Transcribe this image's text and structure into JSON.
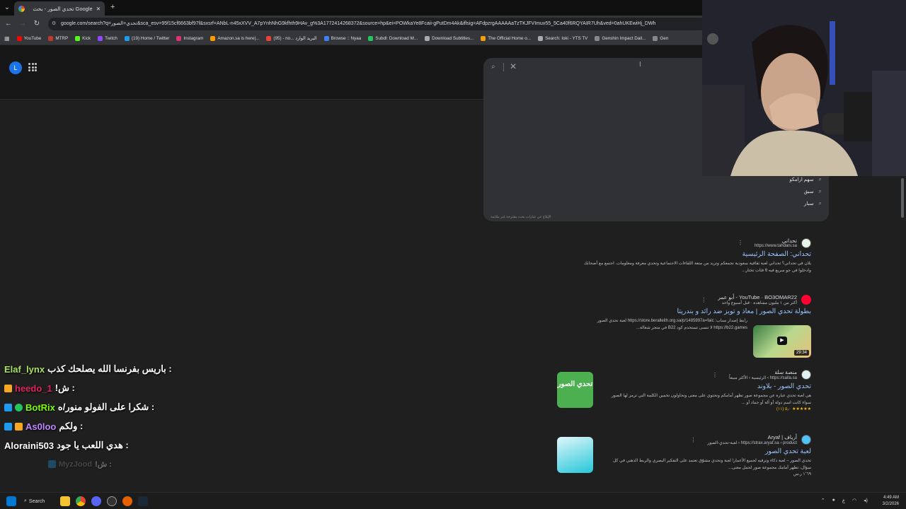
{
  "browser": {
    "tab_title": "تحدي الصور - بحث Google",
    "url": "google.com/search?q=تحدي+الصور&sca_esv=95f15cf6663bf97f&sxsrf=ANbL-n45xXVV_A7pYnhNhG9kfhth9HAv_g%3A1772414268372&source=hp&ei=POWkaYe8Fcaii-gPutDm4Ak&iflsig=AFdpzrgAAAAAaTzTKJFVImuv55_5Ca40f6RQYAIR7Uh&ved=0ahUKEwiHj_DWh",
    "bookmarks": [
      {
        "label": "YouTube",
        "color": "#ff0000"
      },
      {
        "label": "MTRP",
        "color": "#c0392b"
      },
      {
        "label": "Kick",
        "color": "#53fc18"
      },
      {
        "label": "Twitch",
        "color": "#9146ff"
      },
      {
        "label": "(19) Home / Twitter",
        "color": "#1d9bf0"
      },
      {
        "label": "Instagram",
        "color": "#e1306c"
      },
      {
        "label": "Amazon.sa is here|...",
        "color": "#ff9900"
      },
      {
        "label": "(95) - no... البريد الوارد",
        "color": "#ea4335"
      },
      {
        "label": "Browse :: Nyaa",
        "color": "#3b82f6"
      },
      {
        "label": "Subdl: Download M...",
        "color": "#22c55e"
      },
      {
        "label": "Download Subtitles...",
        "color": "#aaaaaa"
      },
      {
        "label": "The Official Home o...",
        "color": "#f59e0b"
      },
      {
        "label": "Search: loki - YTS TV",
        "color": "#aaaaaa"
      },
      {
        "label": "Genshin Impact Dail...",
        "color": "#888888"
      },
      {
        "label": "Gen",
        "color": "#888888"
      }
    ]
  },
  "google": {
    "avatar_letter": "L",
    "suggestions": [
      "سهم ارامكو",
      "سبق",
      "سبار"
    ],
    "report_text": "الإبلاغ عن عبارات بحث مقترحة غير ملائمة"
  },
  "results": [
    {
      "site": "تحداني",
      "url": "https://www.tahdani.sa",
      "title": "تحداني: الصفحة الرئيسية",
      "snippet_1": "يلان في تحداني؟ تحداني لعبة ثقافية سعودية تجمعكم وتزيد من متعة اللقاءات الاجتماعية وتحدي معرفة ومعلومات. اجتمع مع أصحابك",
      "snippet_2": "وادخلوا في جو سريع فيه 6 فئات تختار..."
    },
    {
      "site": "YouTube · BO3OMAR22 - أبو عمر",
      "url": "أكثر من ١ مليون مشاهدة · قبل أسبوع واحد",
      "title": "بطولة تحدي الصور | معاذ و تويز ضد رائد و بندريتا",
      "snippet_1": "رابط إصدار سناب: https://store.beralleith.org.sa/p/1485997a=faic لعبة تحدي الصور",
      "snippet_2": "https://b22.games لا تنسى تستخدم كود B22 في متجر شغالة...",
      "duration": "29:34"
    },
    {
      "site": "منصة سلة",
      "url": "https://salla.sa › الرئيسية › الأكثر مبيعاً",
      "title": "تحدي الصور - بلاوند",
      "snippet_1": "هي لعبة تحدي عبارة عن مجموعة صور تظهر أمامكم وتحتوي على معنى وتحاولون تخمين الكلمة التي ترمز لها الصور",
      "snippet_2": "سواء كانت اسم دولة أو آلة أو جماد أو ...",
      "rating": "★★★★★ ٥٫٠ (١١)",
      "thumb_text": "تحدي الصور"
    },
    {
      "site": "أرياف | Aryaf",
      "url": "https://strax.aryaf.sa › product › لعبة-تحدي-الصور",
      "title": "لعبة تحدي الصور",
      "snippet_1": "تحدي الصور – لعبة ذكاء وترفيه لجميع الأعمار! لعبة وتحدي مشوّق تعتمد على التفكير البصري والربط الذهني في كل",
      "snippet_2": "سؤال، تظهر أمامك مجموعة صور لحمل معنى...",
      "rating": "١٬٦٩ ر.س"
    }
  ],
  "chat": [
    {
      "user": "Elaf_lynx",
      "user_color": "#a8e063",
      "message": ": باريس بفرنسا الله يصلحك كذب",
      "badges": []
    },
    {
      "user": "heedo_1",
      "user_color": "#e0245e",
      "message": ": ش!",
      "badges": [
        "#f5a623"
      ]
    },
    {
      "user": "BotRix",
      "user_color": "#7cfc00",
      "message": ": شكرا على الفولو منور/ه",
      "badges": [
        "#1d9bf0",
        "#22c55e"
      ]
    },
    {
      "user": "As0loo",
      "user_color": "#c084fc",
      "message": ": ولكم",
      "badges": [
        "#1d9bf0",
        "#f5a623"
      ]
    },
    {
      "user": "Aloraini503",
      "user_color": "#ffffff",
      "message": ": هدي اللعب يا جود",
      "badges": []
    },
    {
      "user": "MyzJood",
      "user_color": "#555555",
      "message": ": ش!",
      "badges": []
    }
  ],
  "taskbar": {
    "search_label": "Search",
    "time": "4:49 AM",
    "date": "3/2/2026"
  }
}
